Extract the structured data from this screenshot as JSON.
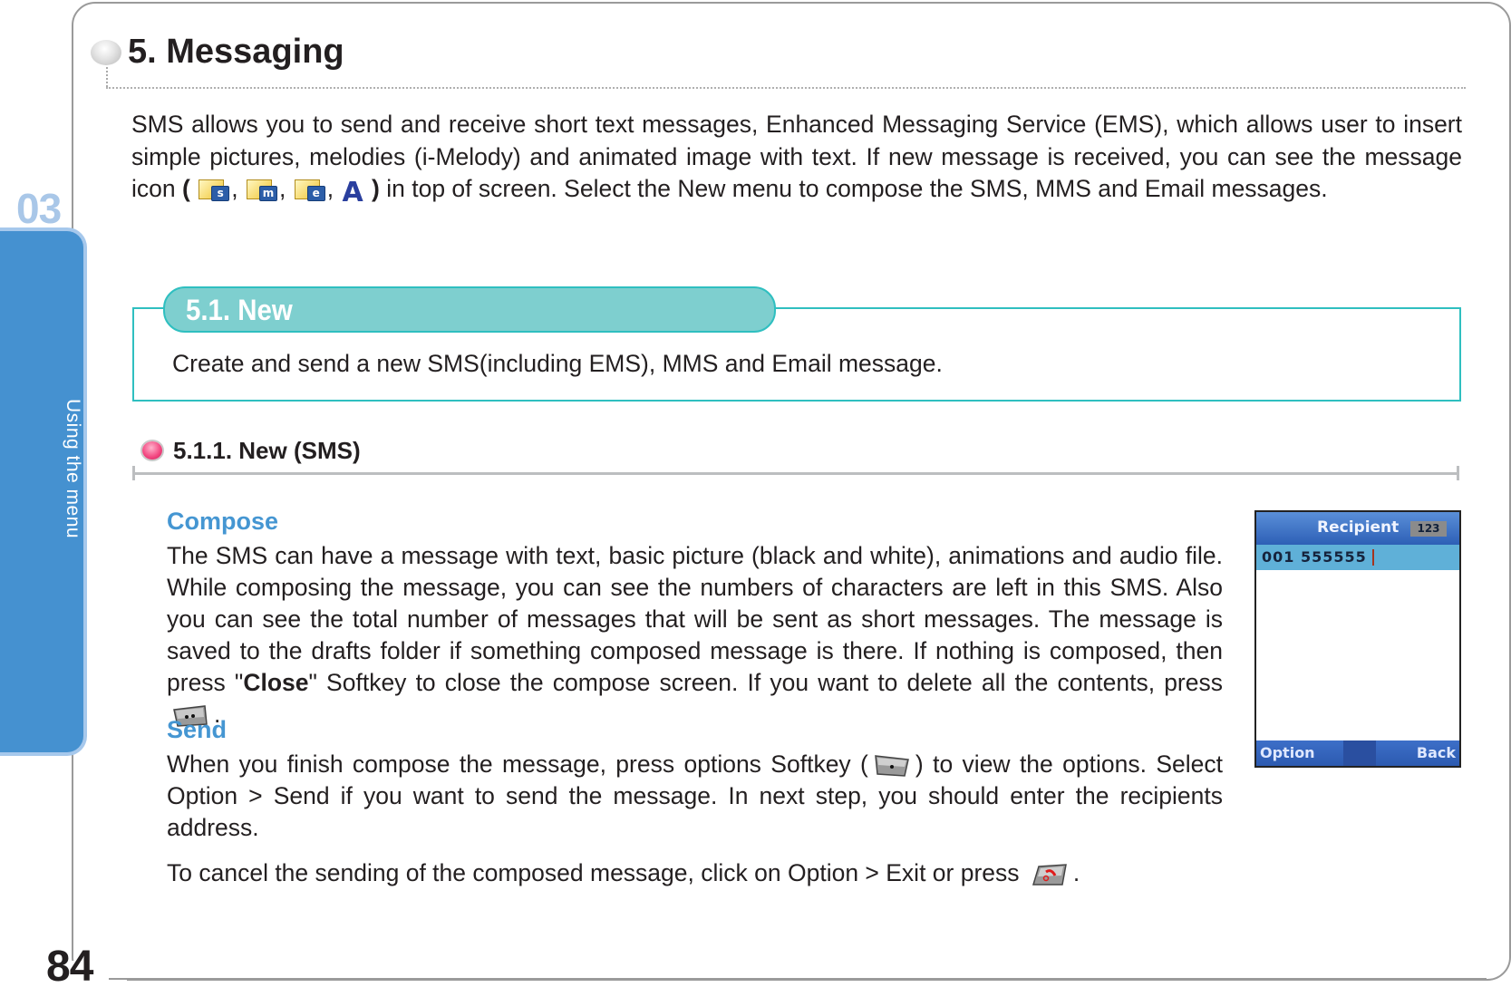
{
  "sidebar": {
    "chapter_number": "03",
    "chapter_label": "Using the menu"
  },
  "page_number": "84",
  "section": {
    "title": "5. Messaging",
    "intro_line1": "SMS allows you to send and receive short text messages, Enhanced Messaging Service (EMS), which allows user to insert simple pictures, melodies (i-Melody) and animated image with text. If new message is received, you can see the message icon",
    "intro_open": "(",
    "intro_close": ")",
    "intro_line2": " in top of screen. Select the New menu to compose the SMS, MMS and Email messages.",
    "status_icons": [
      {
        "name": "sms-message-icon",
        "badge": "s"
      },
      {
        "name": "mms-message-icon",
        "badge": "m"
      },
      {
        "name": "email-message-icon",
        "badge": "e"
      },
      {
        "name": "ems-message-icon",
        "glyph": "A"
      }
    ],
    "icon_separator": ","
  },
  "subsection": {
    "title": "5.1. New",
    "description": "Create and send a new SMS(including EMS), MMS and Email message.",
    "colors": {
      "accent": "#2fbfc0",
      "pill_fill": "#7ecfcf"
    }
  },
  "subsubsection": {
    "title": "5.1.1. New (SMS)",
    "compose": {
      "heading": "Compose",
      "text_a": "The SMS can have a message with text, basic picture (black and white), animations and audio file. While composing the message, you can see the numbers of characters are left in this SMS. Also you can see the total number of messages that will be sent as short messages. The message is saved to the drafts folder if something composed message is there. If nothing is composed, then press \"",
      "close_label": "Close",
      "text_b": "\" Softkey to close the compose screen. If you want to delete all the contents, press",
      "text_end": "."
    },
    "send": {
      "heading": "Send",
      "text_a": "When you finish compose the message, press options Softkey (",
      "text_b": ") to view the options. Select Option > Send if you want to send the message. In next step, you should enter the recipients address.",
      "cancel_text": "To cancel the sending of the composed message, click on Option > Exit or press",
      "cancel_end": "."
    },
    "heading_color": "#4596d2"
  },
  "phone_screen": {
    "title": "Recipient",
    "input_mode": "123",
    "recipient_value": "001 555555",
    "left_softkey": "Option",
    "right_softkey": "Back"
  }
}
